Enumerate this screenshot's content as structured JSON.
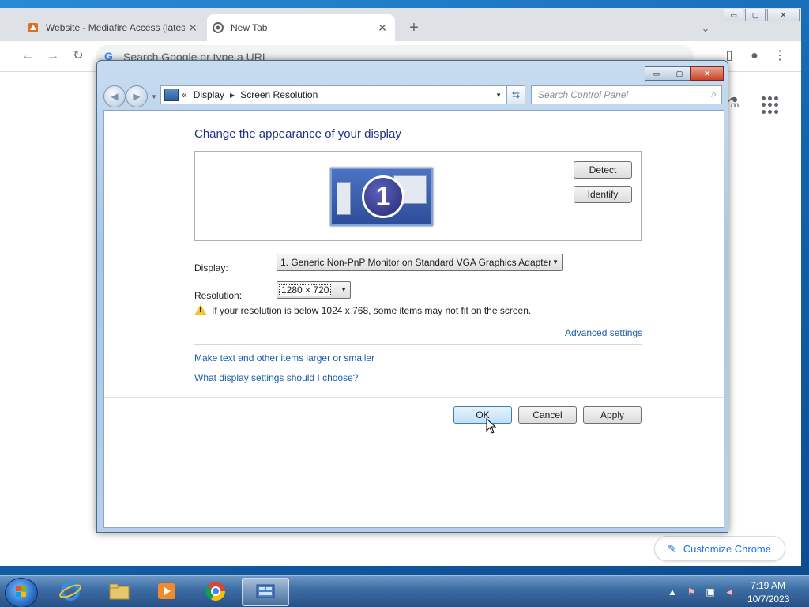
{
  "browser": {
    "tabs": [
      {
        "title": "Website - Mediafire Access (lates",
        "close": "✕"
      },
      {
        "title": "New Tab",
        "close": "✕"
      }
    ],
    "new_tab": "+",
    "tab_search": "⌄",
    "omnibox_placeholder": "Search Google or type a URL",
    "omnibox_g": "G",
    "customize_label": "Customize Chrome",
    "win_buttons": [
      "▭",
      "▢",
      "✕"
    ]
  },
  "window": {
    "buttons": {
      "minimize": "▭",
      "maximize": "▢",
      "close": "✕"
    },
    "breadcrumb": {
      "prefix": "«",
      "items": [
        "Display",
        "Screen Resolution"
      ]
    },
    "search_placeholder": "Search Control Panel",
    "search_icon": "⌕",
    "refresh": "⇆",
    "content": {
      "title": "Change the appearance of your display",
      "monitor_number": "1",
      "detect_label": "Detect",
      "identify_label": "Identify",
      "display_label": "Display:",
      "display_value": "1. Generic Non-PnP Monitor on Standard VGA Graphics Adapter",
      "resolution_label": "Resolution:",
      "resolution_value": "1280 × 720",
      "warning": "If your resolution is below 1024 x 768, some items may not fit on the screen.",
      "advanced_link": "Advanced settings",
      "link_text_size": "Make text and other items larger or smaller",
      "link_display_choose": "What display settings should I choose?",
      "ok_label": "OK",
      "cancel_label": "Cancel",
      "apply_label": "Apply"
    }
  },
  "taskbar": {
    "items": [
      "internet-explorer-icon",
      "file-explorer-icon",
      "media-player-icon",
      "chrome-icon",
      "control-panel-icon"
    ],
    "clock_time": "7:19 AM",
    "clock_date": "10/7/2023"
  }
}
